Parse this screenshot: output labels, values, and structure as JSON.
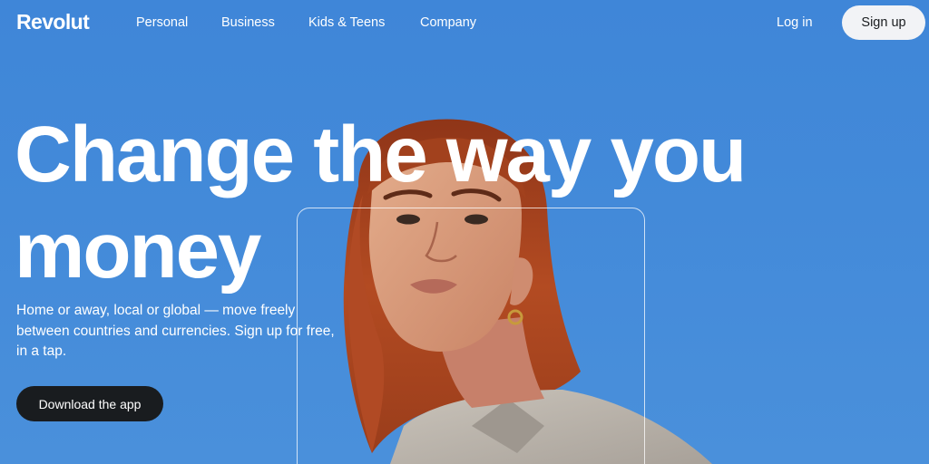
{
  "header": {
    "logo": "Revolut",
    "nav": [
      "Personal",
      "Business",
      "Kids & Teens",
      "Company"
    ],
    "login_label": "Log in",
    "signup_label": "Sign up"
  },
  "hero": {
    "headline_line1": "Change the way you",
    "headline_line2": "money",
    "subtitle_line1": "Home or away, local or global — move freely",
    "subtitle_line2": "between countries and currencies. Sign up for free,",
    "subtitle_line3": "in a tap.",
    "cta_label": "Download the app",
    "image": "woman-portrait"
  },
  "colors": {
    "background": "#438ad9",
    "hair": "#b14a24",
    "skin": "#d79b7b",
    "shirt": "#b9b3aa",
    "cta_background": "#191c1f",
    "signup_background": "#f2f3f6"
  }
}
